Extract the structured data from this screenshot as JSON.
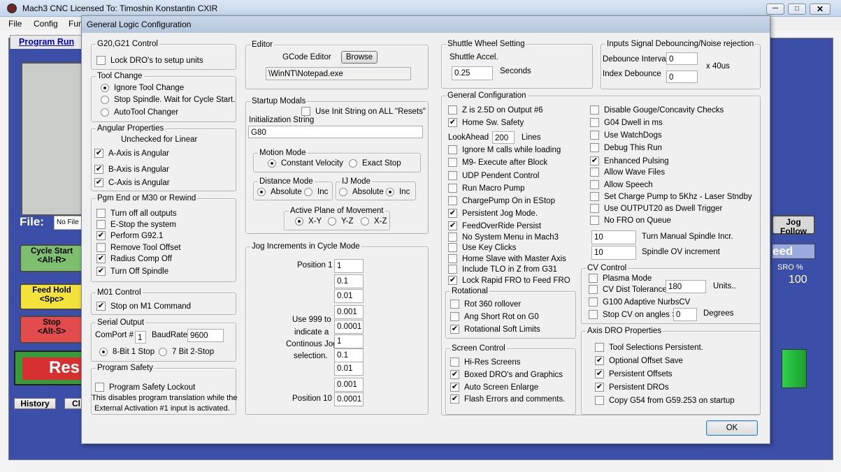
{
  "app": {
    "title": "Mach3 CNC  Licensed To: Timoshin Konstantin CXIR",
    "menu": [
      "File",
      "Config",
      "Fun"
    ],
    "tab": "Program Run",
    "file_label": "File:",
    "file_value": "No File",
    "jog_follow": "Jog\nFollow",
    "feed_label": "eed",
    "sro_label": "SRO %",
    "sro_value": "100",
    "cycle_start": "Cycle Start\n<Alt-R>",
    "feed_hold": "Feed Hold\n<Spc>",
    "stop": "Stop\n<Alt-S>",
    "reset": "Res",
    "history": "History",
    "clear": "Cl"
  },
  "dialog": {
    "title": "General Logic Configuration",
    "ok": "OK"
  },
  "g20": {
    "title": "G20,G21 Control",
    "lock": "Lock DRO's to setup units"
  },
  "tool": {
    "title": "Tool Change",
    "ignore": "Ignore Tool Change",
    "stop": "Stop Spindle. Wait for Cycle Start.",
    "auto": "AutoTool Changer"
  },
  "angular": {
    "title": "Angular Properties",
    "note": "Unchecked for Linear",
    "a": "A-Axis is Angular",
    "b": "B-Axis is Angular",
    "c": "C-Axis is Angular"
  },
  "pgm": {
    "title": "Pgm End or M30 or Rewind",
    "items": [
      "Turn off all outputs",
      "E-Stop the system",
      "Perform G92.1",
      "Remove Tool Offset",
      "Radius Comp Off",
      "Turn Off Spindle"
    ]
  },
  "m01": {
    "title": "M01 Control",
    "stop": "Stop on M1 Command"
  },
  "serial": {
    "title": "Serial Output",
    "comport_label": "ComPort #",
    "comport": "1",
    "baud_label": "BaudRate",
    "baud": "9600",
    "opt1": "8-Bit 1 Stop",
    "opt2": "7 Bit 2-Stop"
  },
  "safety": {
    "title": "Program Safety",
    "lockout": "Program Safety Lockout",
    "desc1": "This disables program translation while the",
    "desc2": "External Activation #1 input is activated."
  },
  "editor": {
    "title": "Editor",
    "label": "GCode Editor",
    "browse": "Browse",
    "path": "\\WinNT\\Notepad.exe"
  },
  "startup": {
    "title": "Startup Modals",
    "use_init": "Use Init String on ALL  \"Resets\"",
    "init_label": "Initialization String",
    "init_value": "G80"
  },
  "motion": {
    "title": "Motion Mode",
    "cv": "Constant Velocity",
    "exact": "Exact Stop"
  },
  "distance": {
    "title": "Distance Mode",
    "abs": "Absolute",
    "inc": "Inc"
  },
  "ij": {
    "title": "IJ Mode",
    "abs": "Absolute",
    "inc": "Inc"
  },
  "plane": {
    "title": "Active Plane of Movement",
    "xy": "X-Y",
    "yz": "Y-Z",
    "xz": "X-Z"
  },
  "jog": {
    "title": "Jog Increments in Cycle Mode",
    "pos1": "Position 1",
    "pos10": "Position 10",
    "note": [
      "Use 999 to",
      "indicate a",
      "Continous Jog",
      "selection."
    ],
    "values": [
      "1",
      "0.1",
      "0.01",
      "0.001",
      "0.0001",
      "1",
      "0.1",
      "0.01",
      "0.001",
      "0.0001"
    ]
  },
  "shuttle": {
    "title": "Shuttle Wheel Setting",
    "label": "Shuttle Accel.",
    "value": "0.25",
    "unit": "Seconds"
  },
  "debounce": {
    "title": "Inputs Signal Debouncing/Noise rejection",
    "interval_label": "Debounce Interval",
    "interval": "0",
    "index_label": "Index Debounce",
    "index": "0",
    "unit": "x 40us"
  },
  "general": {
    "title": "General Configuration",
    "left": [
      "Z is 2.5D on Output #6",
      "Home Sw. Safety",
      "Ignore M calls while loading",
      "M9- Execute after Block",
      "UDP Pendent Control",
      "Run Macro Pump",
      "ChargePump On in EStop",
      "Persistent Jog Mode.",
      "FeedOverRide Persist",
      "No System Menu in Mach3",
      "Use Key Clicks",
      "Home Slave with Master Axis",
      "Include TLO in Z from G31",
      "Lock Rapid FRO to Feed FRO"
    ],
    "lookahead_label": "LookAhead",
    "lookahead": "200",
    "lookahead_unit": "Lines",
    "right": [
      "Disable Gouge/Concavity Checks",
      "G04 Dwell in ms",
      "Use WatchDogs",
      "Debug This Run",
      "Enhanced Pulsing",
      "Allow Wave Files",
      "Allow Speech",
      "Set Charge Pump to 5Khz  - Laser Stndby",
      "Use OUTPUT20 as Dwell Trigger",
      "No FRO on Queue"
    ],
    "spindle_incr": "10",
    "spindle_incr_label": "Turn Manual Spindle Incr.",
    "spindle_ov": "10",
    "spindle_ov_label": "Spindle OV increment"
  },
  "rotational": {
    "title": "Rotational",
    "items": [
      "Rot 360 rollover",
      "Ang Short Rot on G0",
      "Rotational Soft Limits"
    ]
  },
  "cv": {
    "title": "CV Control",
    "plasma": "Plasma Mode",
    "dist": "CV Dist Tolerance",
    "dist_value": "180",
    "dist_unit": "Units..",
    "g100": "G100 Adaptive NurbsCV",
    "stopcv": "Stop CV on angles >",
    "angle": "0",
    "angle_unit": "Degrees"
  },
  "screen": {
    "title": "Screen Control",
    "items": [
      "Hi-Res Screens",
      "Boxed DRO's and Graphics",
      "Auto Screen Enlarge",
      "Flash Errors and comments."
    ]
  },
  "axisdro": {
    "title": "Axis DRO Properties",
    "items": [
      "Tool Selections Persistent.",
      "Optional Offset Save",
      "Persistent Offsets",
      "Persistent DROs",
      "Copy G54 from G59.253 on startup"
    ]
  }
}
